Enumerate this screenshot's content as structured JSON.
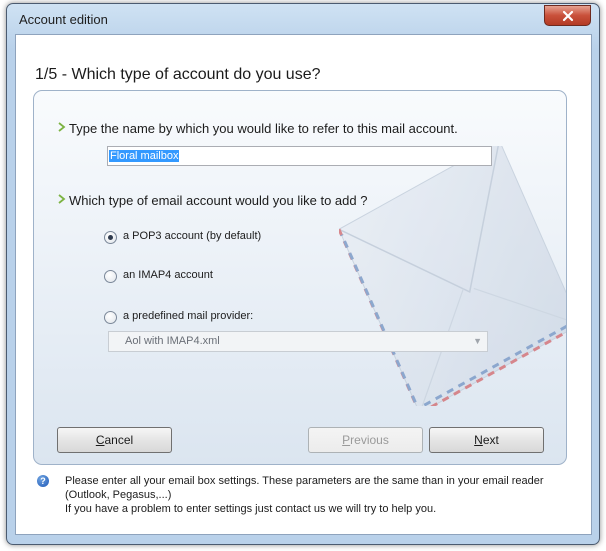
{
  "window": {
    "title": "Account edition"
  },
  "header": {
    "step_title": "1/5 - Which type of account do you use?"
  },
  "questions": {
    "name_question": "Type the name by which you would like to refer to this mail account.",
    "name_value": "Floral mailbox",
    "type_question": "Which type of email account would you like to add ?"
  },
  "account_types": [
    {
      "label": "a POP3 account (by default)",
      "selected": true
    },
    {
      "label": "an IMAP4 account",
      "selected": false
    },
    {
      "label": "a predefined mail provider:",
      "selected": false
    }
  ],
  "provider_select": {
    "value": "Aol with IMAP4.xml"
  },
  "buttons": {
    "cancel_prefix": "C",
    "cancel_rest": "ancel",
    "previous_prefix": "P",
    "previous_rest": "revious",
    "next_prefix": "N",
    "next_rest": "ext"
  },
  "help": {
    "line1": "Please enter all your email box settings. These parameters are the same than in your email reader (Outlook, Pegasus,...)",
    "line2": "If you have a problem to enter settings just contact us we will try to help you."
  },
  "colors": {
    "accent": "#3399ff",
    "chevron": "#7cb342"
  }
}
